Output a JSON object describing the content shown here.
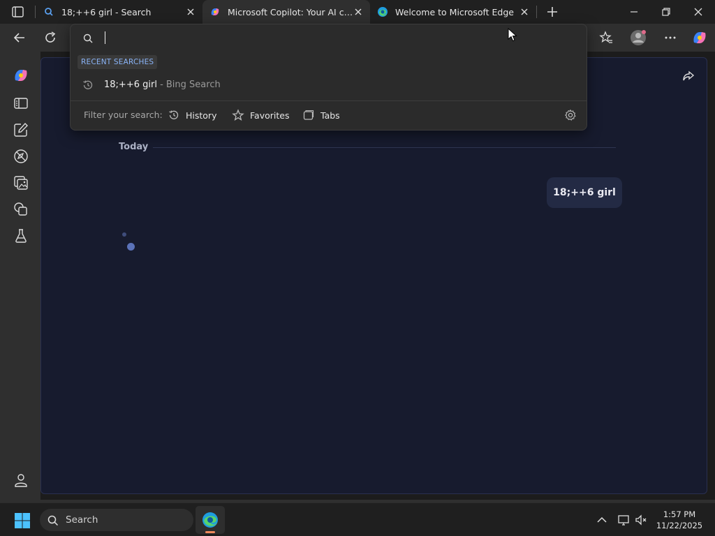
{
  "tabs": [
    {
      "title": "18;++6 girl - Search",
      "favicon": "bing-search-icon"
    },
    {
      "title": "Microsoft Copilot: Your AI companion",
      "favicon": "copilot-icon",
      "active": true
    },
    {
      "title": "Welcome to Microsoft Edge",
      "favicon": "edge-icon"
    }
  ],
  "omnibox": {
    "value": "",
    "recent_label": "RECENT SEARCHES",
    "recent": [
      {
        "query": "18;++6 girl",
        "source": " - Bing Search"
      }
    ],
    "filter_label": "Filter your search:",
    "filters": [
      "History",
      "Favorites",
      "Tabs"
    ]
  },
  "chat": {
    "date_divider": "Today",
    "user_message": "18;++6 girl"
  },
  "taskbar": {
    "search_label": "Search",
    "time": "1:57 PM",
    "date": "11/22/2025"
  },
  "colors": {
    "accent": "#8ab4f8",
    "page_bg": "#171b2e",
    "bubble_bg": "#232a44"
  }
}
